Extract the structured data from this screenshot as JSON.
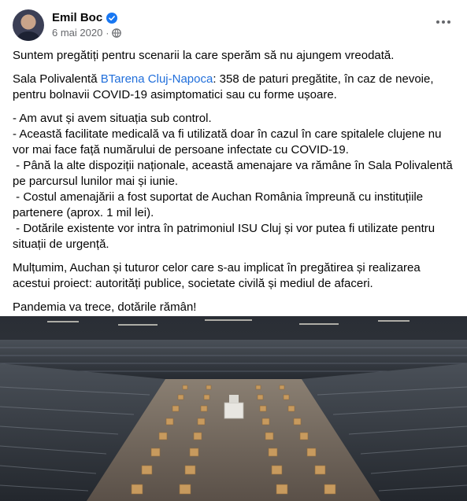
{
  "author": {
    "name": "Emil Boc",
    "date": "6 mai 2020",
    "separator": "·"
  },
  "icons": {
    "verified": "verified-badge-icon",
    "audience": "globe-icon",
    "more": "more-options-icon"
  },
  "colors": {
    "link": "#216fdb",
    "meta": "#65676b",
    "verified": "#1877f2"
  },
  "post": {
    "p1": "Suntem pregătiți pentru scenarii la care sperăm să nu ajungem vreodată.",
    "p2_prefix": "Sala Polivalentă ",
    "p2_link": "BTarena Cluj-Napoca",
    "p2_suffix": ": 358 de paturi pregătite, în caz de nevoie, pentru bolnavii COVID-19 asimptomatici sau cu forme ușoare.",
    "bullets": [
      "- Am avut și avem situația sub control.",
      "- Această facilitate medicală va fi utilizată doar în cazul în care spitalele clujene nu vor mai face față numărului de persoane infectate cu COVID-19.",
      " - Până la alte dispoziții naționale, această amenajare va rămâne în Sala Polivalentă pe parcursul lunilor mai și iunie.",
      " - Costul amenajării a fost suportat de Auchan România împreună cu instituțiile partenere (aprox. 1 mil lei).",
      " - Dotările existente vor intra în patrimoniul ISU Cluj și vor putea fi utilizate pentru situații de urgență."
    ],
    "p4": "Mulțumim, Auchan și tuturor celor care s-au implicat în pregătirea și realizarea acestui proiect: autorități publice, societate civilă și mediul de afaceri.",
    "p5": "Pandemia va trece, dotările rămân!"
  }
}
